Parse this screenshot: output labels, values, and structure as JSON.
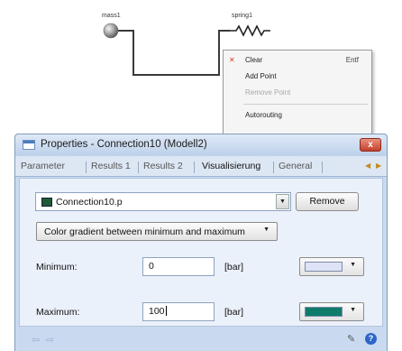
{
  "diagram": {
    "mass_label": "mass1",
    "spring_label": "spring1"
  },
  "context_menu": {
    "items": [
      {
        "label": "Clear",
        "shortcut": "Entf",
        "disabled": false
      },
      {
        "label": "Add Point",
        "shortcut": "",
        "disabled": false
      },
      {
        "label": "Remove Point",
        "shortcut": "",
        "disabled": true
      },
      {
        "label": "Autorouting",
        "shortcut": "",
        "disabled": false
      }
    ]
  },
  "window": {
    "title": "Properties - Connection10 (Modell2)",
    "close_label": "x",
    "tabs": [
      "Parameter",
      "Results 1",
      "Results 2",
      "Visualisierung",
      "General"
    ],
    "active_tab": "Visualisierung",
    "variable_select": "Connection10.p",
    "remove_label": "Remove",
    "gradient_mode": "Color gradient between minimum and maximum",
    "minimum": {
      "label": "Minimum:",
      "value": "0",
      "unit": "[bar]",
      "color": "#dfe3f7"
    },
    "maximum": {
      "label": "Maximum:",
      "value": "100",
      "unit": "[bar]",
      "color": "#0f7b6a"
    }
  },
  "icons": {
    "mass_icon": "gray-sphere",
    "spring_icon": "zigzag-spring",
    "clear_icon": "red-x",
    "window_icon": "window",
    "back_icon": "left-arrow",
    "forward_icon": "right-arrow",
    "pin_icon": "pushpin",
    "help_icon": "question"
  },
  "colors": {
    "connection_line": "#3a3a3a",
    "window_frame": "#c9daf0",
    "panel_bg": "#ebf1fa",
    "close_button": "#c2402a"
  }
}
